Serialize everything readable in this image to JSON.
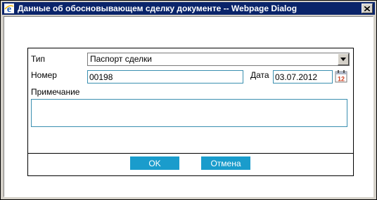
{
  "window": {
    "title": "Данные об обосновывающем сделку документе -- Webpage Dialog",
    "close_label": "×"
  },
  "form": {
    "type_label": "Тип",
    "type_value": "Паспорт сделки",
    "number_label": "Номер",
    "number_value": "00198",
    "date_label": "Дата",
    "date_value": "03.07.2012",
    "calendar_day": "12",
    "note_label": "Примечание",
    "note_value": ""
  },
  "buttons": {
    "ok_label": "OK",
    "cancel_label": "Отмена"
  },
  "colors": {
    "titlebar": "#0a246a",
    "button": "#1a9ccc",
    "field_border": "#3a8fb0"
  },
  "icons": [
    "ie-icon",
    "close-icon",
    "dropdown-arrow-icon",
    "calendar-icon"
  ]
}
